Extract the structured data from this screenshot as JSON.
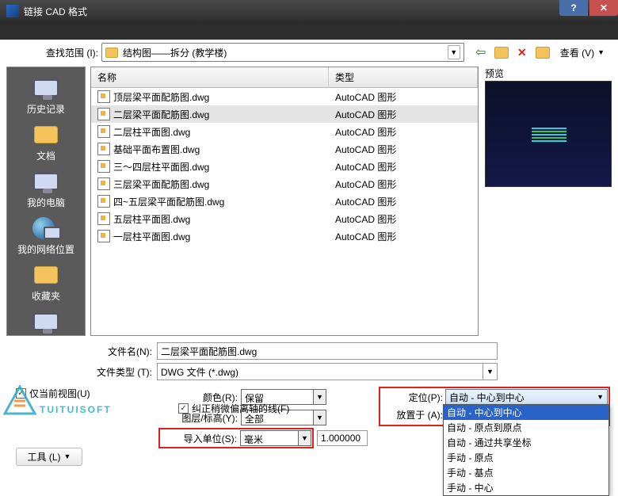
{
  "title": "链接 CAD 格式",
  "lookin_label": "查找范围 (I):",
  "lookin_value": "结构图——拆分 (教学楼)",
  "views_label": "查看 (V)",
  "tools_label": "工具 (L)",
  "places": [
    {
      "label": "历史记录"
    },
    {
      "label": "文档"
    },
    {
      "label": "我的电脑"
    },
    {
      "label": "我的网络位置"
    },
    {
      "label": "收藏夹"
    },
    {
      "label": ""
    }
  ],
  "columns": {
    "name": "名称",
    "type": "类型"
  },
  "files": [
    {
      "name": "顶层梁平面配筋图.dwg",
      "type": "AutoCAD 图形"
    },
    {
      "name": "二层梁平面配筋图.dwg",
      "type": "AutoCAD 图形",
      "selected": true
    },
    {
      "name": "二层柱平面图.dwg",
      "type": "AutoCAD 图形"
    },
    {
      "name": "基础平面布置图.dwg",
      "type": "AutoCAD 图形"
    },
    {
      "name": "三～四层柱平面图.dwg",
      "type": "AutoCAD 图形"
    },
    {
      "name": "三层梁平面配筋图.dwg",
      "type": "AutoCAD 图形"
    },
    {
      "name": "四~五层梁平面配筋图.dwg",
      "type": "AutoCAD 图形"
    },
    {
      "name": "五层柱平面图.dwg",
      "type": "AutoCAD 图形"
    },
    {
      "name": "一层柱平面图.dwg",
      "type": "AutoCAD 图形"
    }
  ],
  "preview_label": "预览",
  "filename_label": "文件名(N):",
  "filename_value": "二层梁平面配筋图.dwg",
  "filetype_label": "文件类型 (T):",
  "filetype_value": "DWG 文件 (*.dwg)",
  "current_view_only": "仅当前视图(U)",
  "colors_label": "颜色(R):",
  "colors_value": "保留",
  "layers_label": "图层/标高(Y):",
  "layers_value": "全部",
  "units_label": "导入单位(S):",
  "units_value": "毫米",
  "units_factor": "1.000000",
  "pos_label": "定位(P):",
  "pos_value": "自动 - 中心到中心",
  "placeat_label": "放置于 (A):",
  "pos_options": [
    "自动 - 中心到中心",
    "自动 - 原点到原点",
    "自动 - 通过共享坐标",
    "手动 - 原点",
    "手动 - 基点",
    "手动 - 中心"
  ],
  "correct_lines": "纠正稍微偏离轴的线(F)",
  "watermark_text": "TUITUISOFT"
}
